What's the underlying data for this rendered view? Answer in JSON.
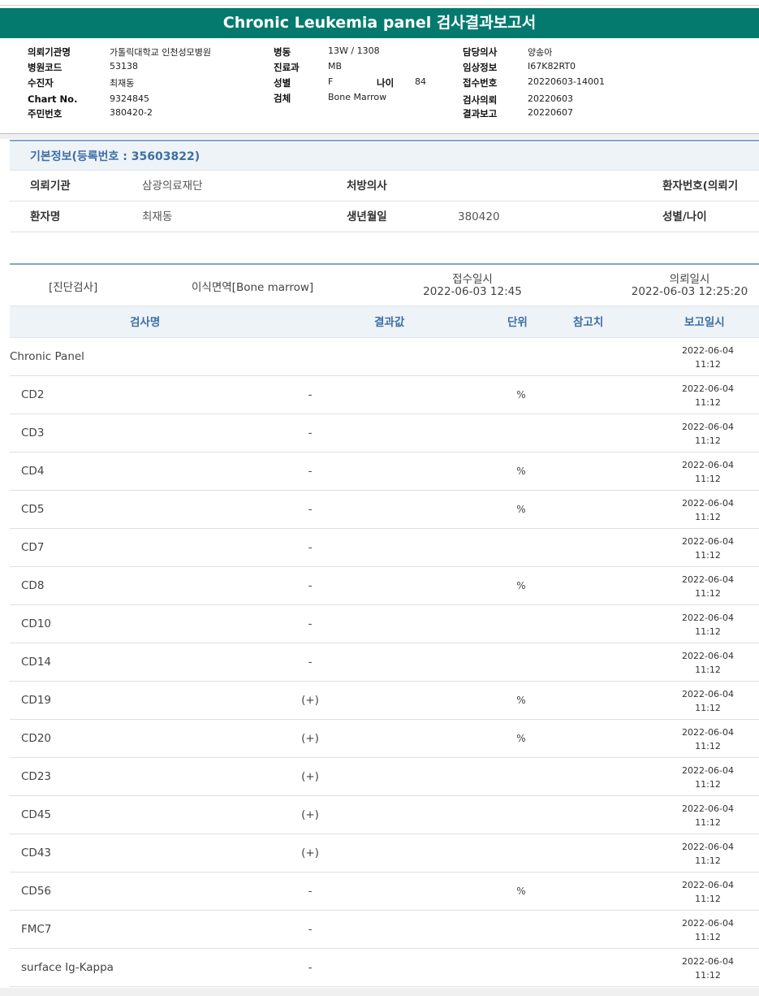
{
  "report": {
    "title": "Chronic Leukemia panel 검사결과보고서",
    "fields": {
      "inst_label": "의뢰기관명",
      "inst_value": "가톨릭대학교 인천성모병원",
      "hospcode_label": "병원코드",
      "hospcode_value": "53138",
      "patient_label": "수진자",
      "patient_value": "최재동",
      "chart_label": "Chart No.",
      "chart_value": "9324845",
      "id_label": "주민번호",
      "id_value": "380420-2",
      "ward_label": "병동",
      "ward_value": "13W / 1308",
      "dept_label": "진료과",
      "dept_value": "MB",
      "sex_label": "성별",
      "sex_value": "F",
      "age_label": "나이",
      "age_value": "84",
      "specimen_label": "검체",
      "specimen_value": "Bone Marrow",
      "doctor_label": "담당의사",
      "doctor_value": "양송아",
      "clinical_label": "임상정보",
      "clinical_value": "I67K82RT0",
      "receipt_label": "접수번호",
      "receipt_value": "20220603-14001",
      "request_label": "검사의뢰",
      "request_value": "20220603",
      "result_label": "결과보고",
      "result_value": "20220607"
    }
  },
  "basic_info": {
    "heading": "기본정보(등록번호 : 35603822)",
    "institution_label": "의뢰기관",
    "institution_value": "삼광의료재단",
    "prescriber_label": "처방의사",
    "patient_no_label": "환자번호(의뢰기",
    "patient_label": "환자명",
    "patient_value": "최재동",
    "birth_label": "생년월일",
    "birth_value": "380420",
    "sex_age_label": "성별/나이"
  },
  "exam": {
    "category": "[진단검사]",
    "test": "이식면역[Bone marrow]",
    "received_label": "접수일시",
    "received_value": "2022-06-03  12:45",
    "requested_label": "의뢰일시",
    "requested_value": "2022-06-03  12:25:20"
  },
  "table": {
    "headers": {
      "name": "검사명",
      "result": "결과값",
      "unit": "단위",
      "ref": "참고치",
      "report": "보고일시"
    },
    "rows": [
      {
        "name": "Chronic Panel",
        "result": "",
        "unit": "",
        "date": "2022-06-04",
        "time": "11:12"
      },
      {
        "name": "CD2",
        "result": "-",
        "unit": "%",
        "date": "2022-06-04",
        "time": "11:12"
      },
      {
        "name": "CD3",
        "result": "-",
        "unit": "",
        "date": "2022-06-04",
        "time": "11:12"
      },
      {
        "name": "CD4",
        "result": "-",
        "unit": "%",
        "date": "2022-06-04",
        "time": "11:12"
      },
      {
        "name": "CD5",
        "result": "-",
        "unit": "%",
        "date": "2022-06-04",
        "time": "11:12"
      },
      {
        "name": "CD7",
        "result": "-",
        "unit": "",
        "date": "2022-06-04",
        "time": "11:12"
      },
      {
        "name": "CD8",
        "result": "-",
        "unit": "%",
        "date": "2022-06-04",
        "time": "11:12"
      },
      {
        "name": "CD10",
        "result": "-",
        "unit": "",
        "date": "2022-06-04",
        "time": "11:12"
      },
      {
        "name": "CD14",
        "result": "-",
        "unit": "",
        "date": "2022-06-04",
        "time": "11:12"
      },
      {
        "name": "CD19",
        "result": "(+)",
        "unit": "%",
        "date": "2022-06-04",
        "time": "11:12"
      },
      {
        "name": "CD20",
        "result": "(+)",
        "unit": "%",
        "date": "2022-06-04",
        "time": "11:12"
      },
      {
        "name": "CD23",
        "result": "(+)",
        "unit": "",
        "date": "2022-06-04",
        "time": "11:12"
      },
      {
        "name": "CD45",
        "result": "(+)",
        "unit": "",
        "date": "2022-06-04",
        "time": "11:12"
      },
      {
        "name": "CD43",
        "result": "(+)",
        "unit": "",
        "date": "2022-06-04",
        "time": "11:12"
      },
      {
        "name": "CD56",
        "result": "-",
        "unit": "%",
        "date": "2022-06-04",
        "time": "11:12"
      },
      {
        "name": "FMC7",
        "result": "-",
        "unit": "",
        "date": "2022-06-04",
        "time": "11:12"
      },
      {
        "name": "surface Ig-Kappa",
        "result": "-",
        "unit": "",
        "date": "2022-06-04",
        "time": "11:12"
      }
    ]
  },
  "colors": {
    "title_bar": "#047a6f",
    "accent_text": "#3d6fa3",
    "header_bg": "#eef3f8"
  }
}
